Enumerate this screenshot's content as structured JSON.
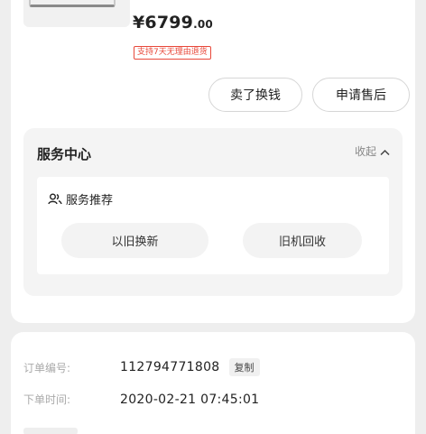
{
  "product": {
    "price_main": "¥6799",
    "price_decimal": ".00",
    "return_badge": "支持7天无理由退货"
  },
  "actions": {
    "sell_label": "卖了换钱",
    "aftersale_label": "申请售后"
  },
  "service_center": {
    "title": "服务中心",
    "collapse_label": "收起",
    "recommend_label": "服务推荐",
    "options": [
      "以旧换新",
      "旧机回收"
    ]
  },
  "order": {
    "number_label": "订单编号:",
    "number_value": "112794771808",
    "copy_label": "复制",
    "time_label": "下单时间:",
    "time_value": "2020-02-21 07:45:01"
  },
  "colors": {
    "accent_red": "#e8483a",
    "background": "#eeeeee"
  }
}
